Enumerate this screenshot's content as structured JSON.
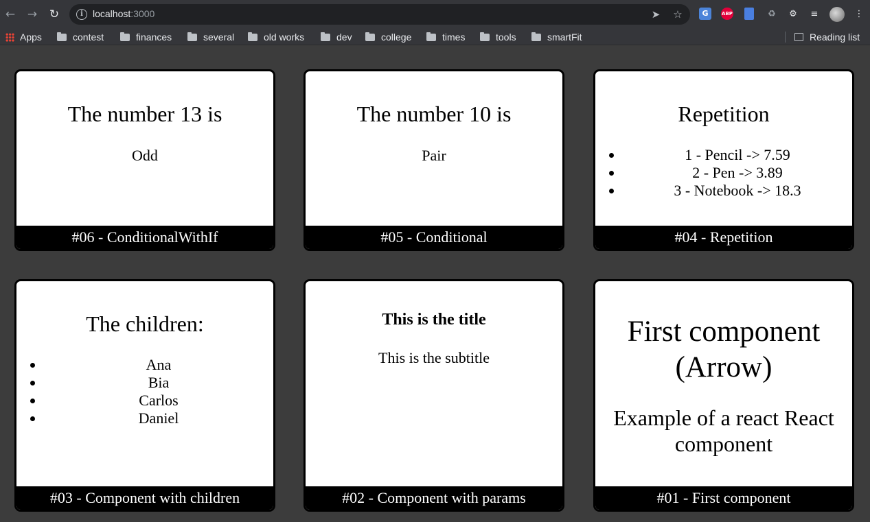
{
  "browser": {
    "url_host": "localhost",
    "url_port": ":3000",
    "bookmarks": [
      "Apps",
      "contest",
      "finances",
      "several",
      "old works",
      "dev",
      "college",
      "times",
      "tools",
      "smartFit"
    ],
    "reading_list": "Reading list",
    "extensions": {
      "abp": "ABP"
    }
  },
  "cards": {
    "c06": {
      "title": "The number 13 is",
      "result": "Odd",
      "footer": "#06 - ConditionalWithIf"
    },
    "c05": {
      "title": "The number 10 is",
      "result": "Pair",
      "footer": "#05 - Conditional"
    },
    "c04": {
      "title": "Repetition",
      "items": [
        "1 - Pencil -> 7.59",
        "2 - Pen -> 3.89",
        "3 - Notebook -> 18.3"
      ],
      "footer": "#04 - Repetition"
    },
    "c03": {
      "title": "The children:",
      "items": [
        "Ana",
        "Bia",
        "Carlos",
        "Daniel"
      ],
      "footer": "#03 - Component with children"
    },
    "c02": {
      "title": "This is the title",
      "subtitle": "This is the subtitle",
      "footer": "#02 - Component with params"
    },
    "c01": {
      "title_line1": "First component",
      "title_line2": "(Arrow)",
      "subtitle_line1": "Example of a react React",
      "subtitle_line2": "component",
      "footer": "#01 - First component"
    }
  }
}
